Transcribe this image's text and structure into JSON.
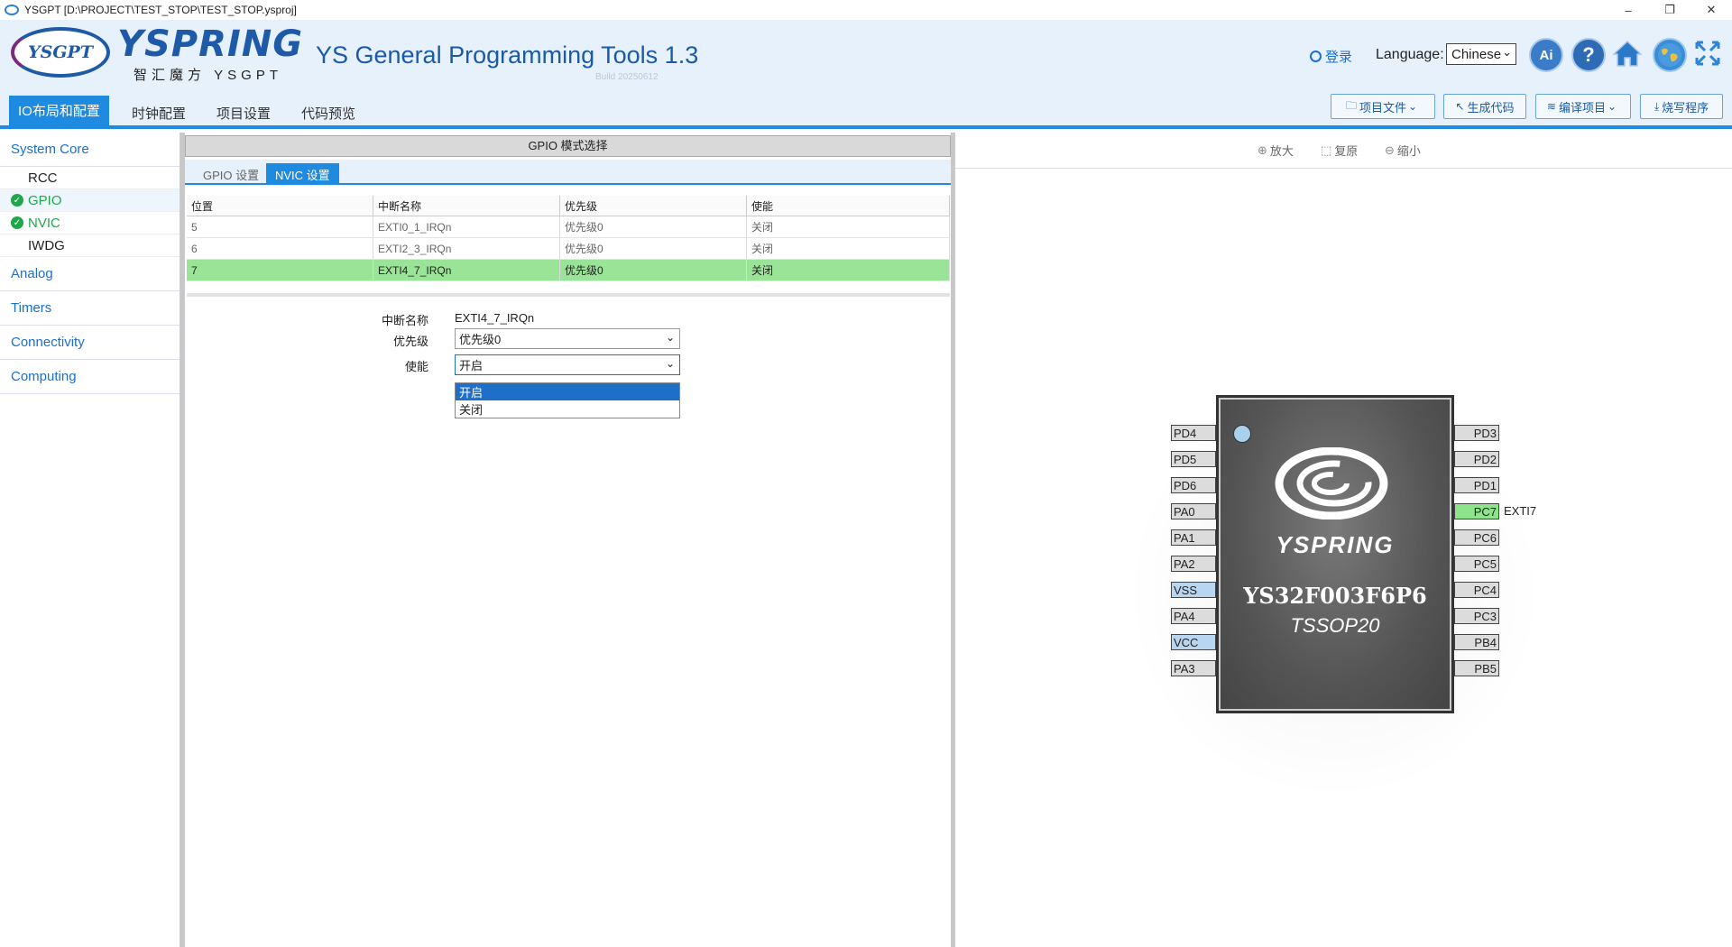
{
  "window": {
    "title": "YSGPT [D:\\PROJECT\\TEST_STOP\\TEST_STOP.ysproj]",
    "minimize": "–",
    "restore": "❐",
    "close": "✕"
  },
  "header": {
    "logo_text": "YSGPT",
    "brand": "YSPRING",
    "brand_sub": "智汇魔方 YSGPT",
    "app_title": "YS General Programming Tools 1.3",
    "build": "Build 20250612",
    "login": "登录",
    "language_label": "Language:",
    "language_value": "Chinese",
    "ai_label": "Ai",
    "help_label": "?"
  },
  "main_tabs": [
    {
      "label": "IO布局和配置"
    },
    {
      "label": "时钟配置"
    },
    {
      "label": "项目设置"
    },
    {
      "label": "代码预览"
    }
  ],
  "actions": [
    {
      "label": "项目文件",
      "icon": "🗀"
    },
    {
      "label": "生成代码",
      "icon": "↖"
    },
    {
      "label": "编译项目",
      "icon": "≋"
    },
    {
      "label": "烧写程序",
      "icon": "⤓"
    }
  ],
  "sidebar": {
    "categories": [
      "System Core",
      "Analog",
      "Timers",
      "Connectivity",
      "Computing"
    ],
    "system_core_items": [
      {
        "label": "RCC"
      },
      {
        "label": "GPIO"
      },
      {
        "label": "NVIC"
      },
      {
        "label": "IWDG"
      }
    ]
  },
  "mid": {
    "header": "GPIO 模式选择",
    "tabs": [
      {
        "label": "GPIO 设置"
      },
      {
        "label": "NVIC 设置"
      }
    ],
    "columns": [
      "位置",
      "中断名称",
      "优先级",
      "使能"
    ],
    "rows": [
      [
        "5",
        "EXTI0_1_IRQn",
        "优先级0",
        "关闭"
      ],
      [
        "6",
        "EXTI2_3_IRQn",
        "优先级0",
        "关闭"
      ],
      [
        "7",
        "EXTI4_7_IRQn",
        "优先级0",
        "关闭"
      ]
    ],
    "form": {
      "name_label": "中断名称",
      "name_value": "EXTI4_7_IRQn",
      "priority_label": "优先级",
      "priority_value": "优先级0",
      "enable_label": "使能",
      "enable_value": "开启",
      "enable_options": [
        "开启",
        "关闭"
      ]
    }
  },
  "right": {
    "zoom_in": "放大",
    "reset": "复原",
    "zoom_out": "缩小",
    "chip": {
      "brand": "YSPRING",
      "part": "YS32F003F6P6",
      "package": "TSSOP20"
    },
    "left_pins": [
      "PD4",
      "PD5",
      "PD6",
      "PA0",
      "PA1",
      "PA2",
      "VSS",
      "PA4",
      "VCC",
      "PA3"
    ],
    "right_pins": [
      "PD3",
      "PD2",
      "PD1",
      "PC7",
      "PC6",
      "PC5",
      "PC4",
      "PC3",
      "PB4",
      "PB5"
    ],
    "pc7_label": "EXTI7"
  },
  "colors": {
    "accent": "#1e8ae0",
    "brand": "#1e5aa8",
    "selected_row": "#99e496",
    "power_pin": "#b9d6f0",
    "used_pin": "#8ee48a"
  }
}
